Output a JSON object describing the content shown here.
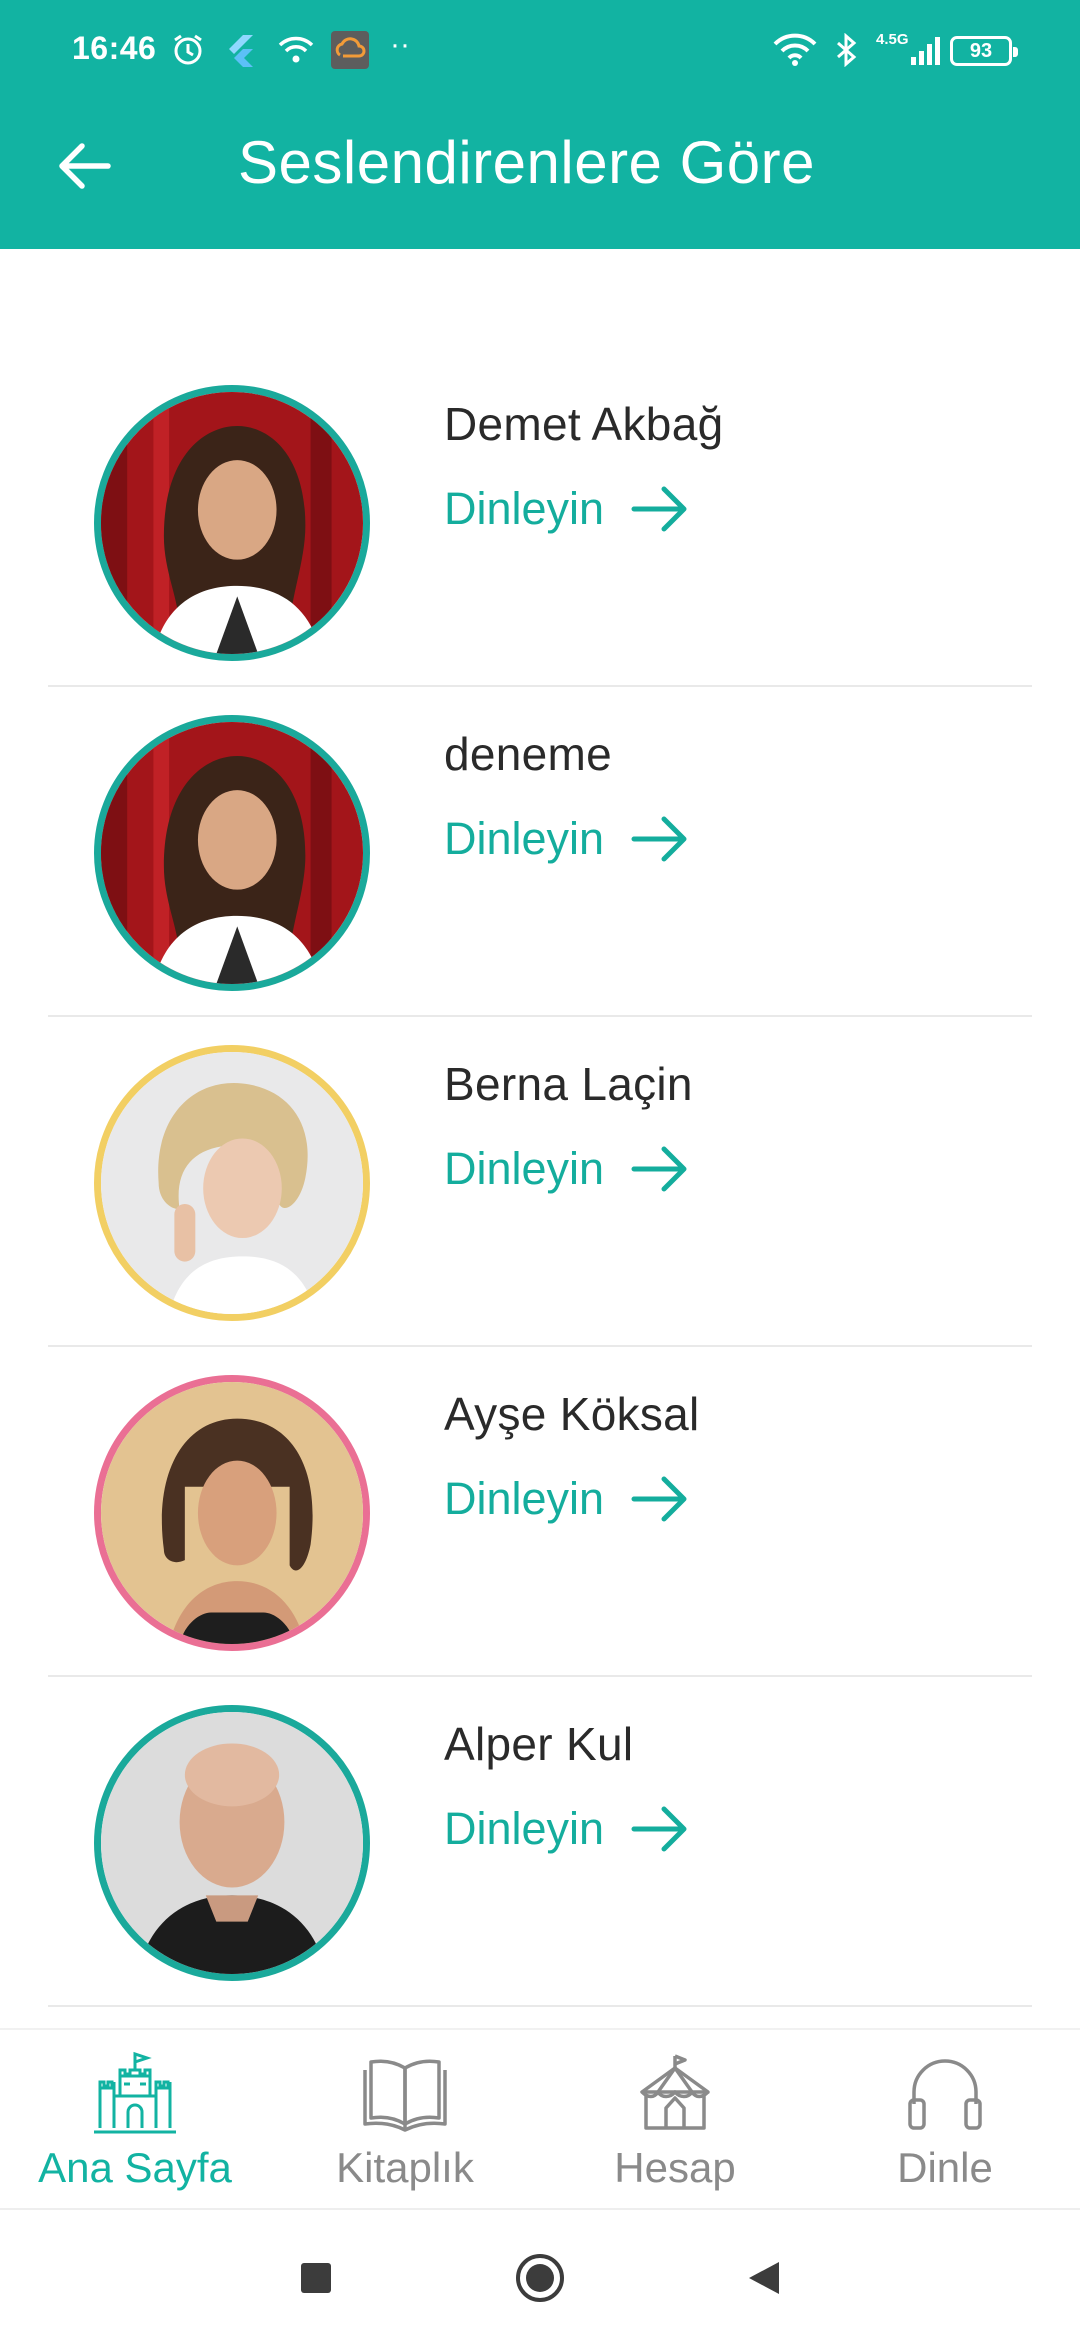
{
  "status_bar": {
    "time": "16:46",
    "network": "4.5G",
    "battery": "93"
  },
  "header": {
    "title": "Seslendirenlere Göre"
  },
  "narrators": [
    {
      "name": "Demet Akbağ",
      "listen_label": "Dinleyin",
      "ring_color": "#1aa99b"
    },
    {
      "name": "deneme",
      "listen_label": "Dinleyin",
      "ring_color": "#1aa99b"
    },
    {
      "name": "Berna Laçin",
      "listen_label": "Dinleyin",
      "ring_color": "#f2cf63"
    },
    {
      "name": "Ayşe Köksal",
      "listen_label": "Dinleyin",
      "ring_color": "#ea6f94"
    },
    {
      "name": "Alper Kul",
      "listen_label": "Dinleyin",
      "ring_color": "#1aa99b"
    }
  ],
  "bottom_nav": {
    "items": [
      {
        "label": "Ana Sayfa",
        "icon": "castle-icon",
        "active": true
      },
      {
        "label": "Kitaplık",
        "icon": "book-icon",
        "active": false
      },
      {
        "label": "Hesap",
        "icon": "circus-tent-icon",
        "active": false
      },
      {
        "label": "Dinle",
        "icon": "headphones-icon",
        "active": false
      }
    ]
  },
  "colors": {
    "brand": "#12b3a2",
    "accent_text": "#14ad9d",
    "inactive": "#8a8a8a"
  }
}
